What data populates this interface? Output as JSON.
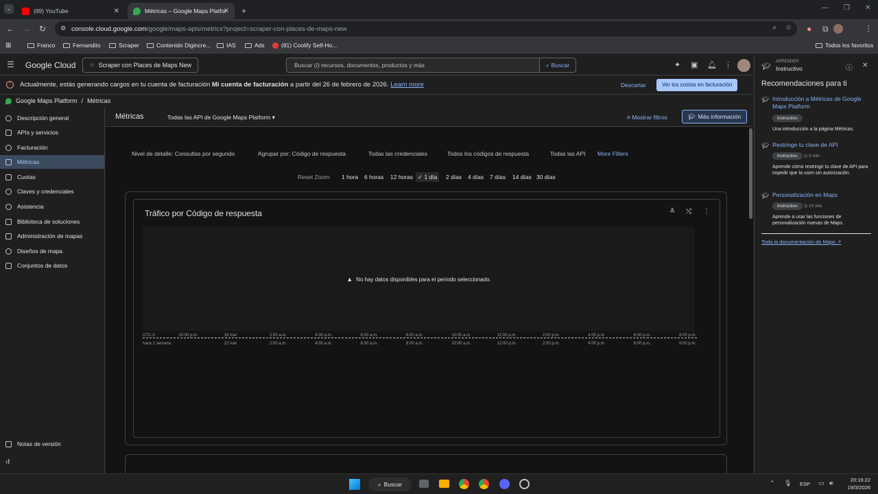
{
  "browser": {
    "tabs": [
      {
        "title": "(89) YouTube",
        "active": false
      },
      {
        "title": "Métricas – Google Maps Platfor",
        "active": true
      }
    ],
    "new_tab": "+",
    "url_host": "console.cloud.google.com",
    "url_path": "/google/maps-apis/metrics?project=scraper-con-places-de-maps-new",
    "bookmarks": [
      "Franco",
      "Fernandito",
      "Scraper",
      "Contenido Digincre...",
      "IAS",
      "Ads",
      "(81) Coolify Self-Ho..."
    ],
    "bookmarks_right": "Todos los favoritos"
  },
  "console": {
    "logo": "Google Cloud",
    "project": "Scraper con Places de Maps New",
    "search_placeholder": "Buscar (/) recursos, documentos, productos y más",
    "search_button": "Buscar"
  },
  "banner": {
    "text_pre": "Actualmente, estás generando cargos en tu cuenta de facturación ",
    "text_bold": "Mi cuenta de facturación",
    "text_post": " a partir del 26 de febrero de 2026.",
    "learn_more": "Learn more",
    "dismiss": "Descartar",
    "view_costs": "Ver los costos en facturación"
  },
  "breadcrumb": {
    "root": "Google Maps Platform",
    "sep": "/",
    "current": "Métricas"
  },
  "sidebar": {
    "items": [
      {
        "label": "Descripción general",
        "active": false
      },
      {
        "label": "APIs y servicios",
        "active": false
      },
      {
        "label": "Facturación",
        "active": false
      },
      {
        "label": "Métricas",
        "active": true
      },
      {
        "label": "Cuotas",
        "active": false
      },
      {
        "label": "Claves y credenciales",
        "active": false
      },
      {
        "label": "Asistencia",
        "active": false
      },
      {
        "label": "Biblioteca de soluciones",
        "active": false
      },
      {
        "label": "Administración de mapas",
        "active": false
      },
      {
        "label": "Diseños de mapa",
        "active": false
      },
      {
        "label": "Conjuntos de datos",
        "active": false
      }
    ],
    "release_notes": "Notas de versión",
    "collapse": "‹I"
  },
  "main": {
    "title": "Métricas",
    "api_selector": "Todas las API de Google Maps Platform",
    "show_filters": "Mostrar filtros",
    "more_info": "Más información",
    "chips": [
      "Nivel de detalle: Consultas por segundo",
      "Agrupar por: Código de respuesta",
      "Todas las credenciales",
      "Todos los códigos de respuesta",
      "Todas las API",
      "More Filters"
    ],
    "reset_zoom": "Reset Zoom",
    "zoom_options": [
      "1 hora",
      "6 horas",
      "12 horas",
      "1 día",
      "2 días",
      "4 días",
      "7 días",
      "14 días",
      "30 días"
    ],
    "zoom_selected": "1 día",
    "chart_title": "Tráfico por Código de respuesta",
    "no_data": "No hay datos disponibles para el período seleccionado.",
    "x_ticks_top": [
      "UTC-3",
      "10:00 p.m.",
      "19 mar",
      "2:00 a.m.",
      "4:00 a.m.",
      "6:00 a.m.",
      "8:00 a.m.",
      "10:00 a.m.",
      "12:00 p.m.",
      "2:00 p.m.",
      "4:00 p.m.",
      "6:00 p.m.",
      "8:00 p.m."
    ],
    "x_ticks_bottom": [
      "hace 1 semana",
      "",
      "12 mar",
      "2:00 a.m.",
      "4:00 a.m.",
      "6:00 a.m.",
      "8:00 a.m.",
      "10:00 a.m.",
      "12:00 p.m.",
      "2:00 p.m.",
      "4:00 p.m.",
      "6:00 p.m.",
      "8:00 p.m."
    ]
  },
  "right_panel": {
    "kicker": "APRENDER",
    "title": "Instructivo",
    "heading": "Recomendaciones para ti",
    "items": [
      {
        "title": "Introducción a Métricas de Google Maps Platform",
        "badge": "Instructivo",
        "time": "",
        "desc": "Una introducción a la página Métricas."
      },
      {
        "title": "Restringe tu clave de API",
        "badge": "Instructivo",
        "time": "3 min",
        "desc": "Aprende cómo restringir tu clave de API para impedir que la usen sin autorización."
      },
      {
        "title": "Personalización en Maps",
        "badge": "Instructivo",
        "time": "10 min",
        "desc": "Aprende a usar las funciones de personalización nuevas de Maps."
      }
    ],
    "all_docs": "Toda la documentación de Maps"
  },
  "taskbar": {
    "search": "Buscar",
    "lang": "ESP",
    "time": "20:16:22",
    "date": "19/3/2026"
  },
  "colors": {
    "accent": "#8ab4f8",
    "active_nav_bg": "#3c4a5e",
    "warning": "#f28b82"
  }
}
